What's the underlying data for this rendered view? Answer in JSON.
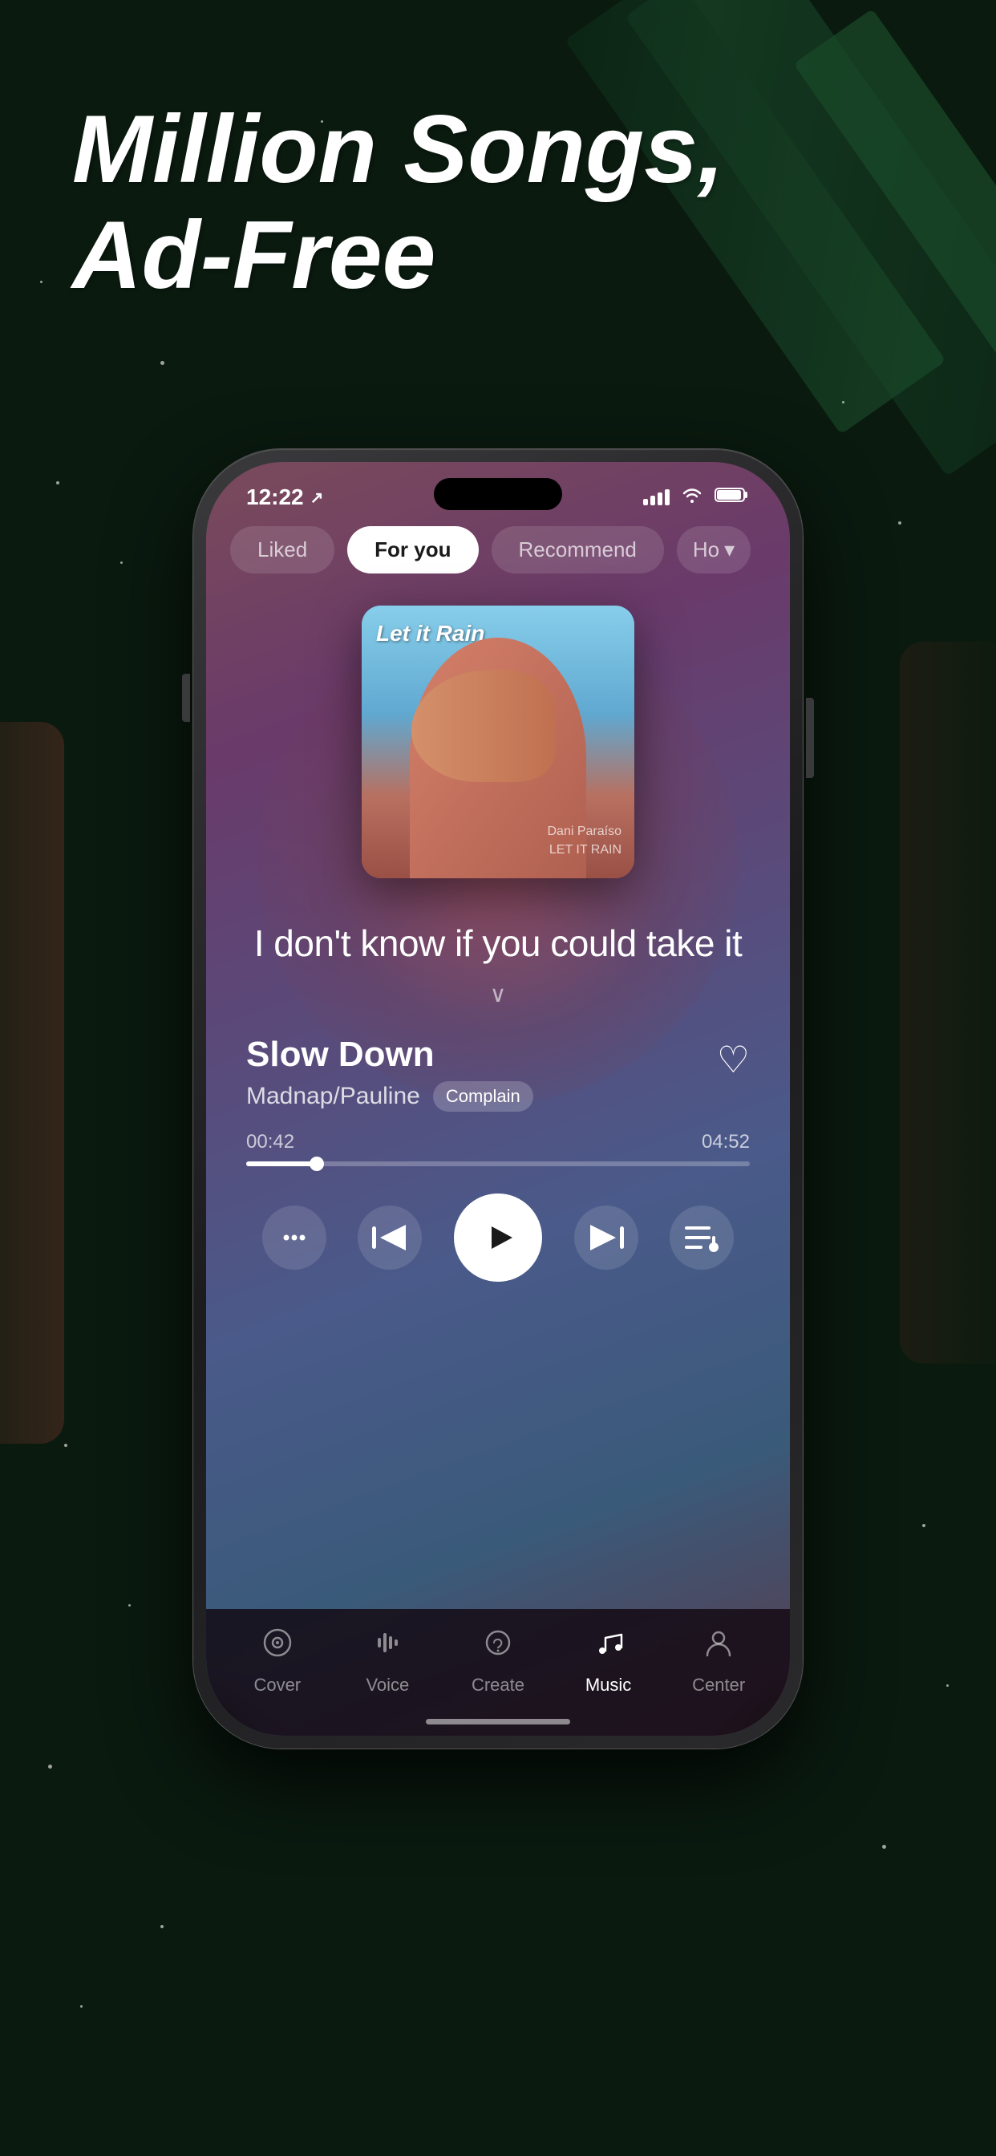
{
  "background": {
    "color": "#0a1a0f"
  },
  "headline": {
    "line1": "Million Songs,",
    "line2": "Ad-Free"
  },
  "phone": {
    "status_bar": {
      "time": "12:22",
      "location_icon": "↗"
    },
    "tabs": [
      {
        "label": "Liked",
        "active": false
      },
      {
        "label": "For you",
        "active": true
      },
      {
        "label": "Recommend",
        "active": false
      },
      {
        "label": "Ho",
        "active": false
      }
    ],
    "album": {
      "title": "Let it Rain",
      "artist_small": "Dani Paraíso\nLET IT RAIN"
    },
    "lyrics": {
      "text": "I don't know if you could take it"
    },
    "song": {
      "title": "Slow Down",
      "artist": "Madnap/Pauline",
      "tag": "Complain",
      "liked": false
    },
    "progress": {
      "current": "00:42",
      "total": "04:52",
      "percent": 14
    },
    "controls": {
      "dots_label": "···",
      "prev_label": "⏮",
      "play_label": "▶",
      "next_label": "⏭",
      "queue_label": "≡"
    },
    "nav": [
      {
        "icon": "🎵",
        "label": "Cover",
        "active": false,
        "icon_type": "cover"
      },
      {
        "icon": "🎙",
        "label": "Voice",
        "active": false,
        "icon_type": "voice"
      },
      {
        "icon": "💡",
        "label": "Create",
        "active": false,
        "icon_type": "create"
      },
      {
        "icon": "🎵",
        "label": "Music",
        "active": true,
        "icon_type": "music"
      },
      {
        "icon": "👤",
        "label": "Center",
        "active": false,
        "icon_type": "center"
      }
    ]
  }
}
